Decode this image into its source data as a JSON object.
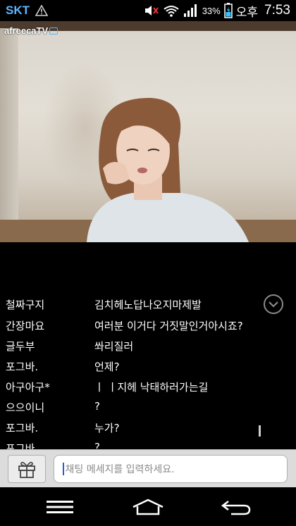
{
  "status_bar": {
    "carrier": "SKT",
    "battery_percent": "33%",
    "ampm": "오후",
    "time": "7:53",
    "icons": [
      "warning-icon",
      "mute-icon",
      "wifi-icon",
      "signal-icon",
      "battery-icon"
    ]
  },
  "video": {
    "logo_text": "afreecaTV"
  },
  "chat": {
    "messages": [
      {
        "user": "철짜구지",
        "text": "김치헤노답나오지마제발"
      },
      {
        "user": "간장마요",
        "text": "여러분 이거다 거짓말인거아시죠?"
      },
      {
        "user": "글두부",
        "text": "쏴리질러"
      },
      {
        "user": "포그바.",
        "text": "언제?"
      },
      {
        "user": "아구아구*",
        "text": "ㅣ ㅣ지헤 낙태하러가는길"
      },
      {
        "user": "으으이니",
        "text": "?"
      },
      {
        "user": "포그바.",
        "text": "누가?"
      },
      {
        "user": "포그바.",
        "text": "?"
      }
    ]
  },
  "input": {
    "placeholder": "채팅 메세지를 입력하세요."
  },
  "nav": {
    "icons": [
      "menu-icon",
      "home-icon",
      "back-icon"
    ]
  },
  "colors": {
    "carrier": "#5fb6ff",
    "background": "#000000",
    "input_bar": "#dcdcdc"
  }
}
